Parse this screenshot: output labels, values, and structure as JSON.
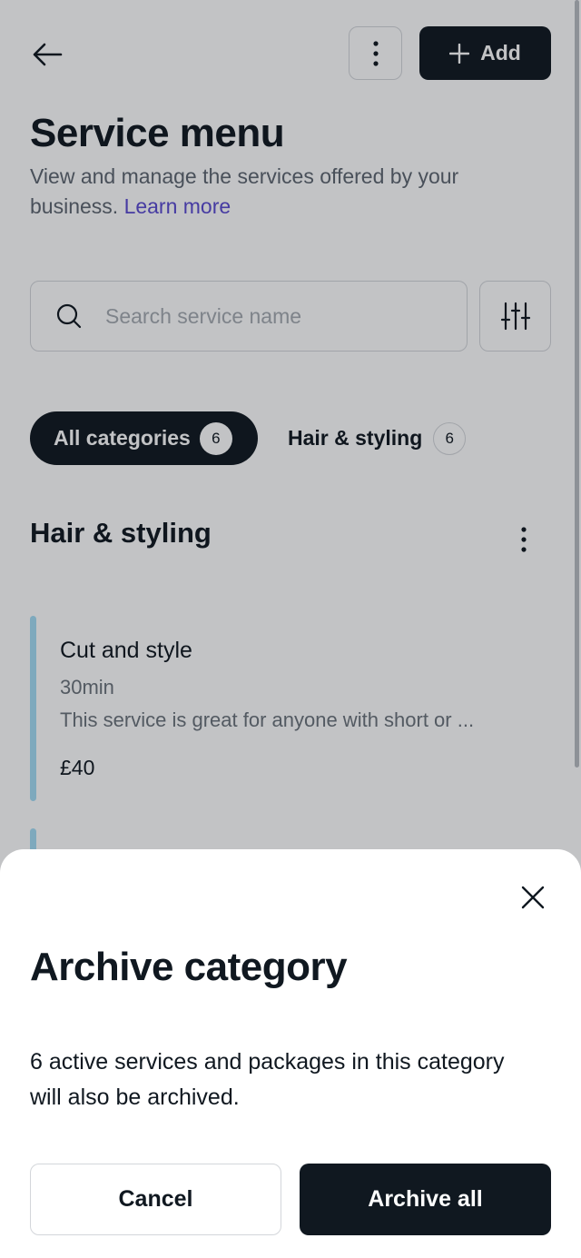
{
  "header": {
    "add_label": "Add",
    "title": "Service menu",
    "description": "View and manage the services offered by your business.",
    "learn_more": "Learn more"
  },
  "search": {
    "placeholder": "Search service name"
  },
  "categories": [
    {
      "label": "All categories",
      "count": "6",
      "selected": true
    },
    {
      "label": "Hair & styling",
      "count": "6",
      "selected": false
    }
  ],
  "section": {
    "title": "Hair & styling",
    "services": [
      {
        "name": "Cut and style",
        "duration": "30min",
        "description": "This service is great for anyone with short or ...",
        "price": "£40"
      }
    ]
  },
  "dialog": {
    "title": "Archive category",
    "body": "6 active services and packages in this category will also be archived.",
    "cancel_label": "Cancel",
    "confirm_label": "Archive all"
  },
  "colors": {
    "primary_dark": "#101820",
    "link": "#5a4ad1",
    "service_accent": "#a5dcf5",
    "overlay": "rgba(13,17,23,0.25)"
  },
  "icons": {
    "back": "arrow-left-icon",
    "more": "more-vertical-icon",
    "add": "plus-icon",
    "search": "search-icon",
    "filter": "sliders-icon",
    "close": "close-icon"
  }
}
